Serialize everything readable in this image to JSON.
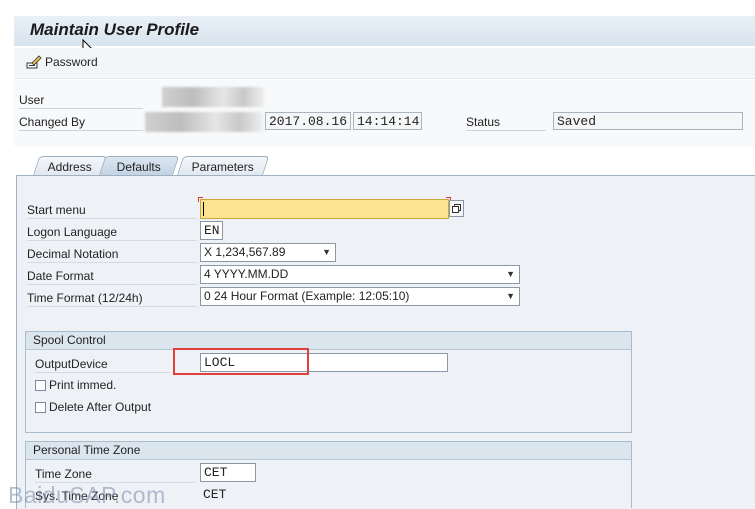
{
  "window": {
    "title": "Maintain User Profile"
  },
  "toolbar": {
    "password_label": "Password",
    "icon": "pencil-key-icon"
  },
  "header": {
    "user_label": "User",
    "changed_by_label": "Changed By",
    "changed_date": "2017.08.16",
    "changed_time": "14:14:14",
    "status_label": "Status",
    "status_value": "Saved"
  },
  "tabs": [
    {
      "label": "Address",
      "active": false
    },
    {
      "label": "Defaults",
      "active": true
    },
    {
      "label": "Parameters",
      "active": false
    }
  ],
  "defaults": {
    "start_menu_label": "Start menu",
    "start_menu_value": "",
    "logon_language_label": "Logon Language",
    "logon_language_value": "EN",
    "decimal_notation_label": "Decimal Notation",
    "decimal_notation_value": "X 1,234,567.89",
    "date_format_label": "Date Format",
    "date_format_value": "4 YYYY.MM.DD",
    "time_format_label": "Time Format (12/24h)",
    "time_format_value": "0 24 Hour Format (Example: 12:05:10)"
  },
  "spool": {
    "title": "Spool Control",
    "output_device_label": "OutputDevice",
    "output_device_value": "LOCL",
    "print_immed_label": "Print immed.",
    "delete_after_output_label": "Delete After Output"
  },
  "timezone": {
    "title": "Personal Time Zone",
    "time_zone_label": "Time Zone",
    "time_zone_value": "CET",
    "sys_time_zone_label": "Sys. Time Zone",
    "sys_time_zone_value": "CET"
  },
  "watermark": "BaiduSAP.com"
}
